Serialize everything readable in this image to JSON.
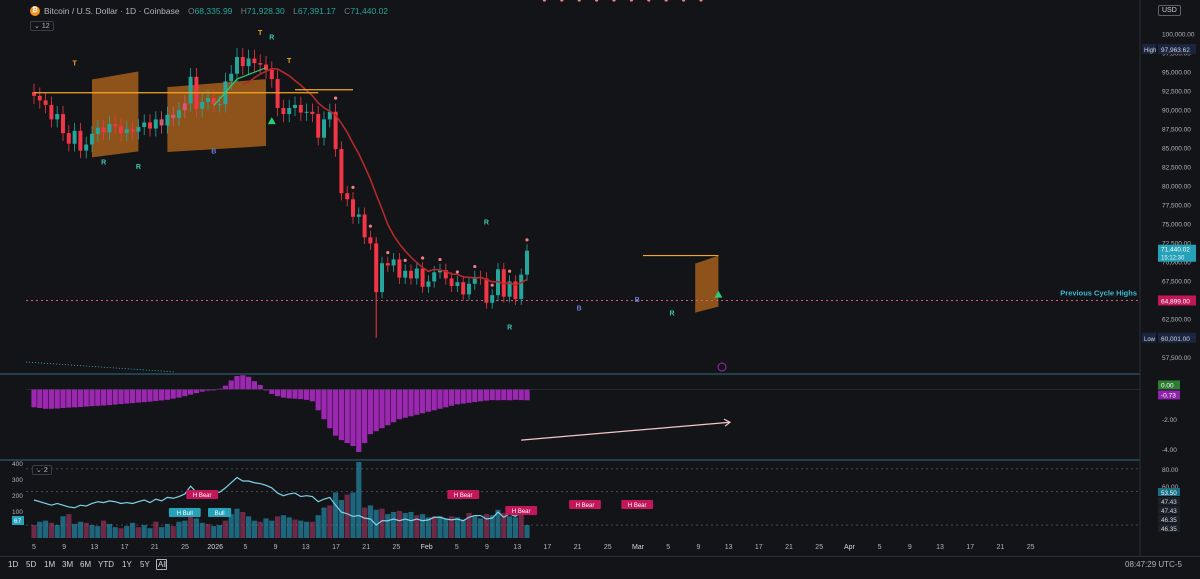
{
  "header": {
    "title": "Bitcoin / U.S. Dollar · 1D · Coinbase",
    "open_label": "O",
    "open": "68,335.99",
    "high_label": "H",
    "high": "71,928.30",
    "low_label": "L",
    "low": "67,391.17",
    "close_label": "C",
    "close": "71,440.02",
    "indicator_count": "12",
    "pane2_indicator_count": "2",
    "currency": "USD"
  },
  "toolbar": {
    "timeframes": [
      "1D",
      "5D",
      "1M",
      "3M",
      "6M",
      "YTD",
      "1Y",
      "5Y",
      "All"
    ],
    "clock": "08:47:29 UTC-5"
  },
  "colors": {
    "up": "#26a69a",
    "down": "#f23645",
    "ma": "#b22a2a",
    "orange_line": "#f5a623",
    "band": "#b8681b",
    "histogram": "#9c27b0",
    "rsi": "#7fd3e6",
    "prev_cycle": "#e0568a"
  },
  "chart_data": [
    {
      "type": "candlestick",
      "y_scale": "linear",
      "ylim": [
        55500,
        101500
      ],
      "y_ticks": [
        "100,000.00",
        "97,500.00",
        "95,000.00",
        "92,500.00",
        "90,000.00",
        "87,500.00",
        "85,000.00",
        "82,500.00",
        "80,000.00",
        "77,500.00",
        "75,000.00",
        "72,500.00",
        "70,000.00",
        "67,500.00",
        "65,000.00",
        "62,500.00",
        "60,000.00",
        "57,500.00"
      ],
      "x_ticks": [
        "5",
        "9",
        "13",
        "17",
        "21",
        "25",
        "2026",
        "5",
        "9",
        "13",
        "17",
        "21",
        "25",
        "Feb",
        "5",
        "9",
        "13",
        "17",
        "21",
        "25",
        "Mar",
        "5",
        "9",
        "13",
        "17",
        "21",
        "25",
        "Apr",
        "5",
        "9",
        "13",
        "17",
        "21",
        "25"
      ],
      "closes": [
        91800,
        91200,
        90600,
        88700,
        89400,
        86900,
        85500,
        87200,
        84600,
        85400,
        86800,
        87600,
        87000,
        88100,
        87800,
        86900,
        87400,
        87100,
        87700,
        88300,
        87500,
        88700,
        87900,
        89300,
        88900,
        89900,
        90800,
        94300,
        90100,
        91000,
        91500,
        90700,
        90700,
        93700,
        94700,
        96900,
        95700,
        96700,
        96100,
        95900,
        95200,
        94000,
        90200,
        89400,
        90200,
        90600,
        89600,
        89700,
        89400,
        86300,
        88700,
        89700,
        84800,
        79000,
        78200,
        75900,
        76200,
        73200,
        72400,
        66000,
        69800,
        69500,
        70300,
        67900,
        68800,
        67800,
        69100,
        66700,
        67400,
        68600,
        68900,
        67800,
        66800,
        67300,
        65700,
        67100,
        68000,
        67800,
        64600,
        65600,
        69000,
        65400,
        67400,
        65100,
        68300,
        71440
      ],
      "annotations": {
        "high_label": "High",
        "high_value": "97,963.62",
        "low_label": "Low",
        "low_value": "60,001.00",
        "last_price": "71,440.02",
        "countdown": "15:12:30",
        "prev_cycle_label": "Previous Cycle Highs",
        "prev_cycle_value": "64,899.00",
        "markers": [
          "T",
          "T",
          "T",
          "R",
          "R",
          "R",
          "R",
          "R",
          "R",
          "B",
          "B",
          "B"
        ]
      }
    },
    {
      "type": "histogram",
      "ylim": [
        -4.6,
        0.9
      ],
      "y_ticks": [
        "-2.00",
        "-4.00"
      ],
      "badges": [
        "0.00",
        "-0.73"
      ],
      "values": [
        -1.2,
        -1.25,
        -1.3,
        -1.3,
        -1.28,
        -1.25,
        -1.22,
        -1.2,
        -1.18,
        -1.15,
        -1.12,
        -1.1,
        -1.08,
        -1.05,
        -1.02,
        -0.98,
        -0.95,
        -0.92,
        -0.88,
        -0.85,
        -0.82,
        -0.78,
        -0.74,
        -0.7,
        -0.62,
        -0.55,
        -0.45,
        -0.35,
        -0.25,
        -0.15,
        -0.08,
        -0.02,
        0.05,
        0.25,
        0.6,
        0.9,
        0.95,
        0.85,
        0.55,
        0.3,
        -0.05,
        -0.3,
        -0.45,
        -0.55,
        -0.6,
        -0.62,
        -0.65,
        -0.7,
        -0.8,
        -1.4,
        -2.0,
        -2.6,
        -3.1,
        -3.4,
        -3.6,
        -3.8,
        -4.2,
        -3.6,
        -3.0,
        -2.8,
        -2.6,
        -2.4,
        -2.2,
        -2.0,
        -1.9,
        -1.8,
        -1.7,
        -1.6,
        -1.5,
        -1.4,
        -1.3,
        -1.2,
        -1.1,
        -1.0,
        -0.95,
        -0.9,
        -0.85,
        -0.8,
        -0.75,
        -0.72,
        -0.73,
        -0.72,
        -0.73,
        -0.7,
        -0.72,
        -0.73
      ]
    },
    {
      "type": "line_with_volume",
      "ylim": [
        0,
        88
      ],
      "y_ticks_right": [
        "80.00",
        "60.00"
      ],
      "y_ticks_left": [
        "400",
        "300",
        "200",
        "100"
      ],
      "badges": [
        "53.50",
        "47.43",
        "47.43",
        "46.35",
        "46.35"
      ],
      "left_badge": "67",
      "rsi": [
        44,
        42,
        40,
        38,
        40,
        38,
        36,
        35,
        38,
        37,
        40,
        42,
        41,
        43,
        42,
        40,
        41,
        40,
        42,
        44,
        41,
        45,
        43,
        47,
        46,
        48,
        51,
        60,
        53,
        54,
        55,
        53,
        53,
        58,
        64,
        70,
        66,
        66,
        64,
        63,
        61,
        58,
        52,
        49,
        51,
        52,
        48,
        49,
        48,
        42,
        45,
        47,
        38,
        30,
        28,
        25,
        26,
        23,
        22,
        15,
        20,
        20,
        22,
        20,
        22,
        20,
        22,
        20,
        21,
        24,
        24,
        22,
        21,
        22,
        20,
        24,
        26,
        26,
        22,
        23,
        30,
        24,
        28,
        25,
        30,
        34
      ],
      "volume": [
        120,
        150,
        160,
        140,
        120,
        200,
        220,
        130,
        150,
        140,
        120,
        110,
        160,
        130,
        100,
        90,
        110,
        140,
        100,
        120,
        90,
        150,
        100,
        130,
        110,
        150,
        160,
        200,
        180,
        140,
        130,
        110,
        120,
        160,
        220,
        270,
        240,
        200,
        160,
        150,
        180,
        160,
        200,
        210,
        190,
        170,
        160,
        150,
        150,
        210,
        280,
        300,
        420,
        350,
        400,
        420,
        700,
        280,
        300,
        260,
        270,
        220,
        240,
        250,
        230,
        240,
        210,
        220,
        190,
        200,
        200,
        180,
        200,
        190,
        170,
        230,
        200,
        180,
        220,
        210,
        260,
        230,
        200,
        190,
        220,
        120
      ],
      "labels": [
        "H Bear",
        "H Bull",
        "Bull",
        "H Bear",
        "H Bear",
        "H Bear",
        "H Bear"
      ]
    }
  ]
}
